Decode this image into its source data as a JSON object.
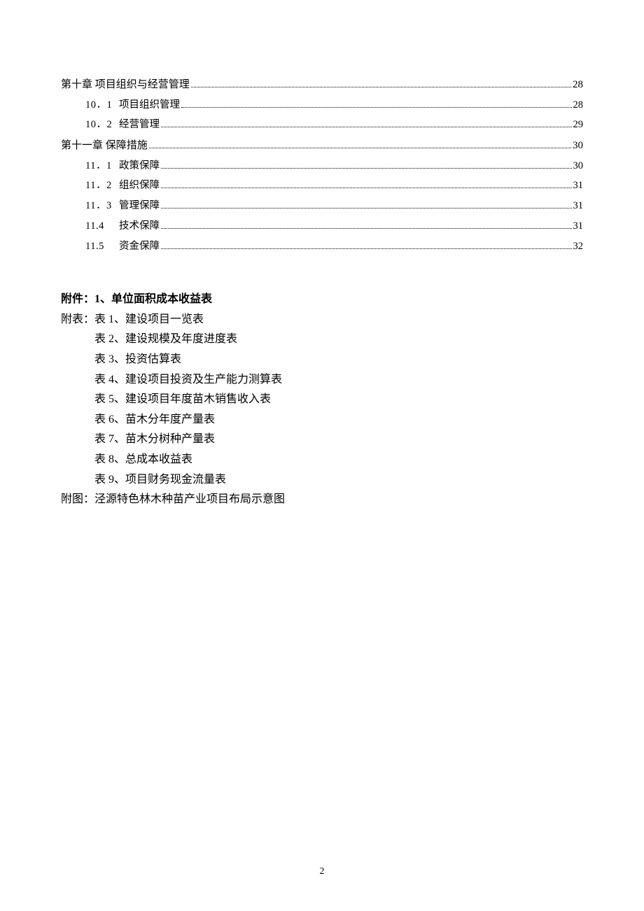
{
  "toc": [
    {
      "type": "chapter",
      "num": "",
      "title": "第十章  项目组织与经营管理",
      "page": "28"
    },
    {
      "type": "sub",
      "num": "10．1",
      "title": "项目组织管理",
      "page": "28"
    },
    {
      "type": "sub",
      "num": "10．2",
      "title": "经营管理",
      "page": "29"
    },
    {
      "type": "chapter",
      "num": "",
      "title": "第十一章  保障措施",
      "page": "30"
    },
    {
      "type": "sub",
      "num": "11．1",
      "title": "政策保障",
      "page": "30"
    },
    {
      "type": "sub",
      "num": "11．2",
      "title": "组织保障",
      "page": "31"
    },
    {
      "type": "sub",
      "num": "11．3",
      "title": "管理保障",
      "page": "31"
    },
    {
      "type": "sub",
      "num": "11.4",
      "title": "技术保障",
      "page": "31"
    },
    {
      "type": "sub",
      "num": "11.5",
      "title": "资金保障",
      "page": "32"
    }
  ],
  "appendix": {
    "fujian_label": "附件：",
    "fujian_item": "1、单位面积成本收益表",
    "fubiao_label": "附表：",
    "tables": [
      "表 1、建设项目一览表",
      "表 2、建设规模及年度进度表",
      "表 3、投资估算表",
      "表 4、建设项目投资及生产能力测算表",
      "表 5、建设项目年度苗木销售收入表",
      "表 6、苗木分年度产量表",
      "表 7、苗木分树种产量表",
      "表 8、总成本收益表",
      "表 9、项目财务现金流量表"
    ],
    "futu_label": "附图：",
    "futu_item": "泾源特色林木种苗产业项目布局示意图"
  },
  "page_number": "2"
}
